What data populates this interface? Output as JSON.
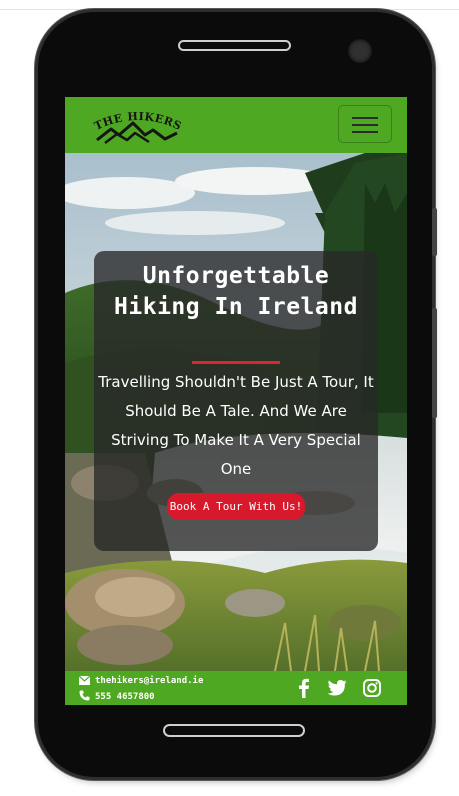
{
  "brand": {
    "logo_text": "THE HIKERS",
    "primary_color": "#4ea821",
    "accent_color": "#d7192b"
  },
  "navbar": {
    "menu_icon": "hamburger-menu-icon"
  },
  "hero": {
    "title": "Unforgettable Hiking In Ireland",
    "tagline": "Travelling Shouldn't Be Just A Tour, It Should Be A Tale. And We Are Striving To Make It A Very Special One",
    "cta_label": "Book A Tour With Us!"
  },
  "footer": {
    "email": "thehikers@ireland.ie",
    "phone": "555 4657800",
    "social": [
      "facebook-icon",
      "twitter-icon",
      "instagram-icon"
    ]
  }
}
